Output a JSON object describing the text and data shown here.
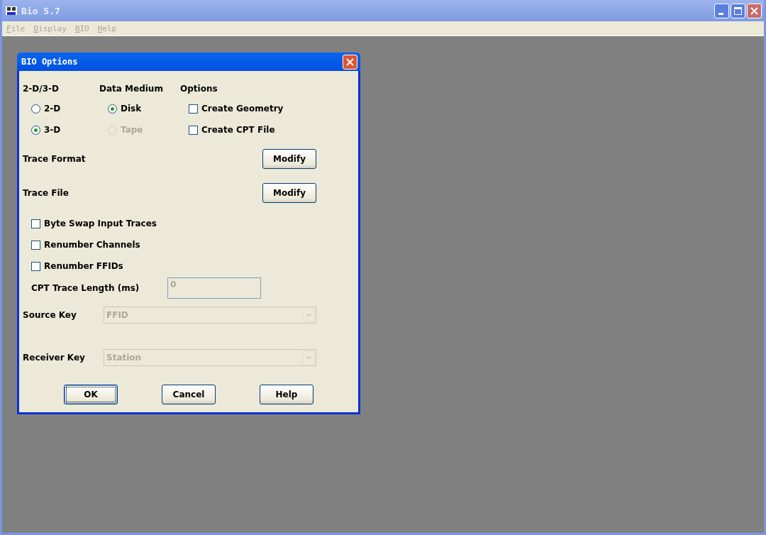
{
  "window": {
    "title": "Bio 5.7",
    "active": false
  },
  "menu": [
    {
      "label": "File",
      "disabled": true
    },
    {
      "label": "Display",
      "disabled": true
    },
    {
      "label": "BIO",
      "disabled": true
    },
    {
      "label": "Help",
      "disabled": true
    }
  ],
  "dialog": {
    "title": "BIO Options",
    "dimension": {
      "heading": "2-D/3-D",
      "options": [
        {
          "label": "2-D",
          "selected": false,
          "disabled": false
        },
        {
          "label": "3-D",
          "selected": true,
          "disabled": false
        }
      ]
    },
    "medium": {
      "heading": "Data Medium",
      "options": [
        {
          "label": "Disk",
          "selected": true,
          "disabled": false
        },
        {
          "label": "Tape",
          "selected": false,
          "disabled": true
        }
      ]
    },
    "options": {
      "heading": "Options",
      "items": [
        {
          "label": "Create Geometry",
          "checked": false
        },
        {
          "label": "Create CPT File",
          "checked": false
        }
      ]
    },
    "trace_format": {
      "label": "Trace Format",
      "button": "Modify"
    },
    "trace_file": {
      "label": "Trace File",
      "button": "Modify"
    },
    "flags": [
      {
        "label": "Byte Swap Input Traces",
        "checked": false
      },
      {
        "label": "Renumber Channels",
        "checked": false
      },
      {
        "label": "Renumber FFIDs",
        "checked": false
      }
    ],
    "cpt_length": {
      "label": "CPT Trace Length (ms)",
      "value": "0",
      "disabled": true
    },
    "source_key": {
      "label": "Source Key",
      "value": "FFID",
      "disabled": true
    },
    "receiver_key": {
      "label": "Receiver Key",
      "value": "Station",
      "disabled": true
    },
    "buttons": [
      {
        "label": "OK",
        "default": true
      },
      {
        "label": "Cancel",
        "default": false
      },
      {
        "label": "Help",
        "default": false
      }
    ]
  }
}
